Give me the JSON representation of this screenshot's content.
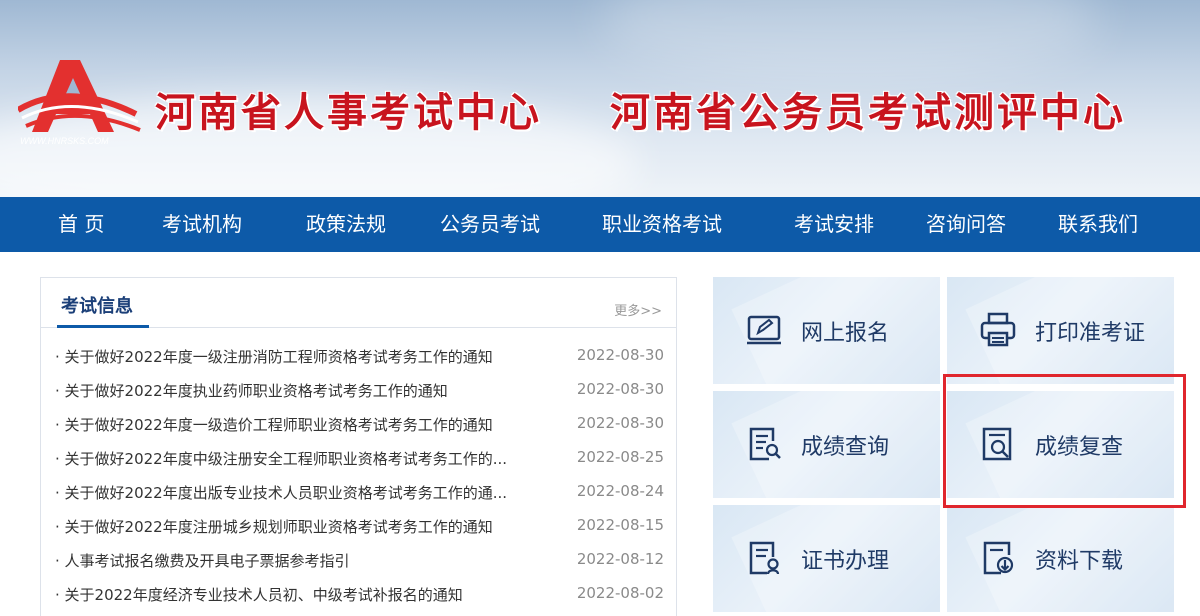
{
  "header": {
    "logo_url_text": "WWW.HNRSKS.COM",
    "title_1": "河南省人事考试中心",
    "title_2": "河南省公务员考试测评中心",
    "title_color": "#c8141e"
  },
  "nav": {
    "items": [
      {
        "label": "首 页"
      },
      {
        "label": "考试机构"
      },
      {
        "label": "政策法规"
      },
      {
        "label": "公务员考试"
      },
      {
        "label": "职业资格考试"
      },
      {
        "label": "考试安排"
      },
      {
        "label": "咨询问答"
      },
      {
        "label": "联系我们"
      }
    ],
    "bg_color": "#0d5aa8"
  },
  "exam_info": {
    "title": "考试信息",
    "more": "更多>>",
    "items": [
      {
        "title": "· 关于做好2022年度一级注册消防工程师资格考试考务工作的通知",
        "date": "2022-08-30"
      },
      {
        "title": "· 关于做好2022年度执业药师职业资格考试考务工作的通知",
        "date": "2022-08-30"
      },
      {
        "title": "· 关于做好2022年度一级造价工程师职业资格考试考务工作的通知",
        "date": "2022-08-30"
      },
      {
        "title": "· 关于做好2022年度中级注册安全工程师职业资格考试考务工作的...",
        "date": "2022-08-25"
      },
      {
        "title": "· 关于做好2022年度出版专业技术人员职业资格考试考务工作的通...",
        "date": "2022-08-24"
      },
      {
        "title": "· 关于做好2022年度注册城乡规划师职业资格考试考务工作的通知",
        "date": "2022-08-15"
      },
      {
        "title": "· 人事考试报名缴费及开具电子票据参考指引",
        "date": "2022-08-12"
      },
      {
        "title": "· 关于2022年度经济专业技术人员初、中级考试补报名的通知",
        "date": "2022-08-02"
      }
    ]
  },
  "services": {
    "tiles": [
      {
        "label": "网上报名",
        "icon": "online-registration-icon"
      },
      {
        "label": "打印准考证",
        "icon": "printer-icon"
      },
      {
        "label": "成绩查询",
        "icon": "score-query-icon"
      },
      {
        "label": "成绩复查",
        "icon": "score-review-icon"
      },
      {
        "label": "证书办理",
        "icon": "certificate-icon"
      },
      {
        "label": "资料下载",
        "icon": "download-icon"
      }
    ],
    "highlight_color": "#e0262d"
  }
}
